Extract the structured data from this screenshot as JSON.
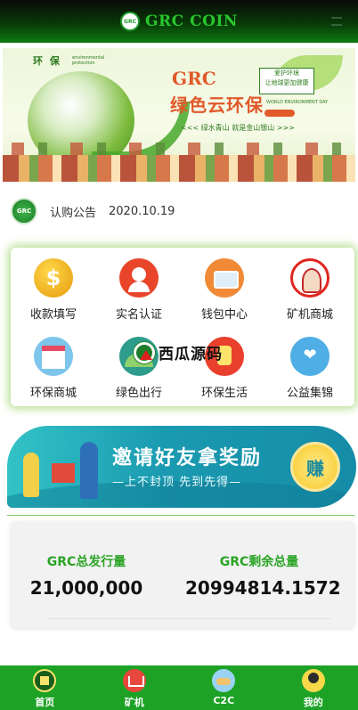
{
  "header": {
    "title": "GRC COIN",
    "logo_text": "GRC"
  },
  "banner": {
    "huanbao": "环 保",
    "env_protection": "environmental protection",
    "grc": "GRC",
    "slogan": "绿色云环保",
    "box_line1": "爱护环境",
    "box_line2": "让地球更加健康",
    "world_day": "WORLD ENVIRONMENT DAY",
    "bottom_text": "<<< 绿水青山 就是金山银山 >>>"
  },
  "notice": {
    "icon_text": "GRC",
    "text": "认购公告",
    "date": "2020.10.19"
  },
  "menu": {
    "items": [
      {
        "label": "收款填写",
        "icon": "coin-icon"
      },
      {
        "label": "实名认证",
        "icon": "id-verify-icon"
      },
      {
        "label": "钱包中心",
        "icon": "wallet-icon"
      },
      {
        "label": "矿机商城",
        "icon": "miner-mall-icon"
      },
      {
        "label": "环保商城",
        "icon": "shop-icon"
      },
      {
        "label": "绿色出行",
        "icon": "green-travel-icon"
      },
      {
        "label": "环保生活",
        "icon": "eco-life-icon"
      },
      {
        "label": "公益集锦",
        "icon": "charity-icon"
      }
    ]
  },
  "watermark": {
    "text": "西瓜源码"
  },
  "invite": {
    "title": "邀请好友拿奖励",
    "subtitle": "—上不封顶 先到先得—",
    "button": "赚"
  },
  "stats": {
    "total_label": "GRC总发行量",
    "total_value": "21,000,000",
    "remaining_label": "GRC剩余总量",
    "remaining_value": "20994814.1572"
  },
  "nav": {
    "items": [
      {
        "label": "首页",
        "icon": "home-icon"
      },
      {
        "label": "矿机",
        "icon": "miner-icon"
      },
      {
        "label": "C2C",
        "icon": "c2c-icon"
      },
      {
        "label": "我的",
        "icon": "profile-icon"
      }
    ]
  },
  "colors": {
    "brand_green": "#1da226",
    "title_green": "#28c62c",
    "accent_teal": "#1a9ab0"
  }
}
